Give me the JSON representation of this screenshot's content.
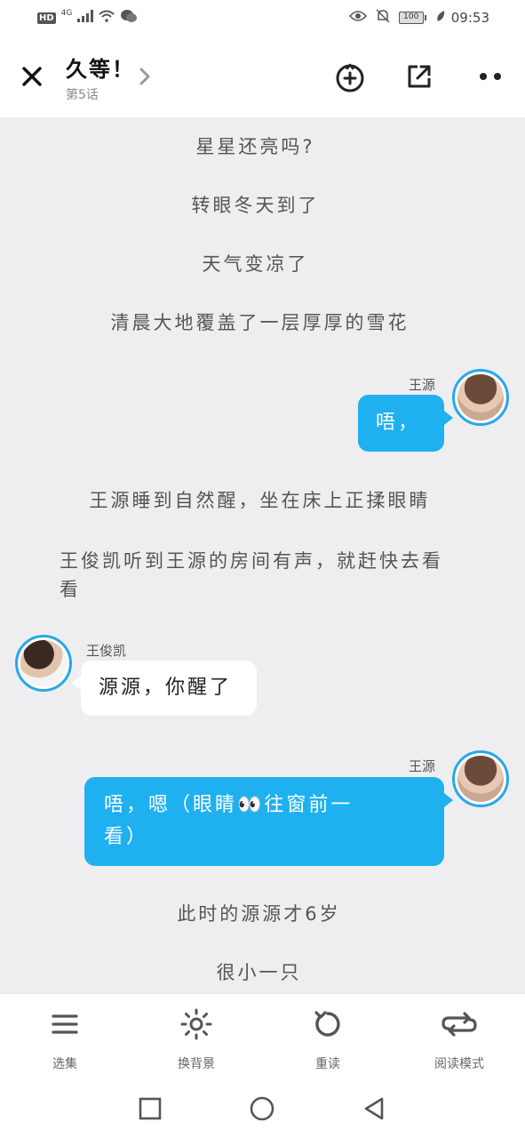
{
  "status_bar": {
    "hd": "HD",
    "network": "4G",
    "battery": "100",
    "time": "09:53",
    "icons": [
      "signal-icon",
      "wifi-icon",
      "wechat-icon",
      "eye-icon",
      "mute-bell-icon",
      "leaf-icon"
    ]
  },
  "header": {
    "title": "久等！",
    "subtitle": "第5话"
  },
  "narration": {
    "line1": "星星还亮吗?",
    "line2": "转眼冬天到了",
    "line3": "天气变凉了",
    "line4": "清晨大地覆盖了一层厚厚的雪花",
    "line5": "王源睡到自然醒，坐在床上正揉眼睛",
    "line6a": "王俊凯听到王源的房间有声，就赶快去看",
    "line6b": "看",
    "line7": "此时的源源才6岁",
    "line8": "很小一只"
  },
  "messages": {
    "m1": {
      "speaker": "王源",
      "text": "唔，"
    },
    "m2": {
      "speaker": "王俊凯",
      "text": "源源，你醒了"
    },
    "m3": {
      "speaker": "王源",
      "line1": "唔，嗯（眼睛👀往窗前一",
      "line2": "看）"
    }
  },
  "toolbar": {
    "chapters": "选集",
    "background": "换背景",
    "reread": "重读",
    "read_mode": "阅读模式"
  },
  "colors": {
    "accent": "#1fb0ef",
    "avatar_ring": "#27a8e8",
    "page_bg": "#eeeef0"
  }
}
